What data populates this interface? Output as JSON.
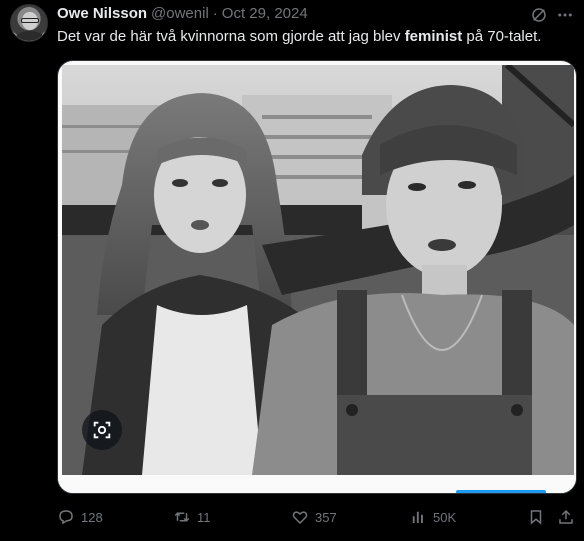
{
  "tweet": {
    "author_name": "Owe Nilsson",
    "handle": "@owenil",
    "separator": "·",
    "date": "Oct 29, 2024",
    "text_before": "Det var de här två kvinnorna som gjorde att jag blev ",
    "text_bold": "feminist",
    "text_after": " på 70-talet."
  },
  "actions": {
    "replies": "128",
    "retweets": "11",
    "likes": "357",
    "views": "50K"
  },
  "icons": {
    "avatar": "profile-photo",
    "grok": "grok-icon",
    "more": "more-icon",
    "lens": "lens-icon",
    "reply": "reply-icon",
    "retweet": "retweet-icon",
    "like": "heart-icon",
    "views": "views-icon",
    "bookmark": "bookmark-icon",
    "share": "share-icon"
  },
  "colors": {
    "background": "#000000",
    "text": "#e7e9ea",
    "muted": "#71767b",
    "accent": "#1d9bf0"
  }
}
